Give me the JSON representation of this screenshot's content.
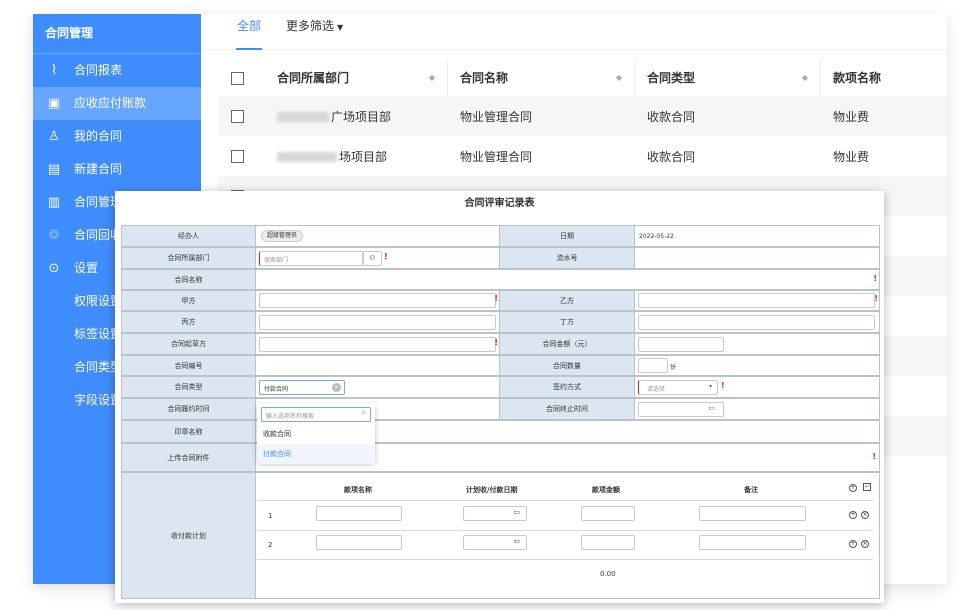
{
  "sidebar": {
    "title": "合同管理",
    "items": [
      {
        "label": "合同报表",
        "icon": "chart-line-icon",
        "active": false
      },
      {
        "label": "应收应付账款",
        "icon": "wallet-icon",
        "active": true
      },
      {
        "label": "我的合同",
        "icon": "user-icon",
        "active": false
      },
      {
        "label": "新建合同",
        "icon": "add-document-icon",
        "active": false
      },
      {
        "label": "合同管理",
        "icon": "manage-document-icon",
        "active": false
      },
      {
        "label": "合同回收",
        "icon": "recycle-bin-icon",
        "active": false
      },
      {
        "label": "设置",
        "icon": "settings-icon",
        "active": false
      }
    ],
    "sub_items": [
      "权限设置",
      "标签设置",
      "合同类型",
      "字段设置"
    ]
  },
  "tabs": {
    "all": "全部",
    "more": "更多筛选"
  },
  "table": {
    "headers": [
      "合同所属部门",
      "合同名称",
      "合同类型",
      "款项名称"
    ],
    "rows": [
      {
        "dept": "广场项目部",
        "name": "物业管理合同",
        "type": "收款合同",
        "item": "物业费"
      },
      {
        "dept": "场项目部",
        "name": "物业管理合同",
        "type": "收款合同",
        "item": "物业费"
      }
    ]
  },
  "form": {
    "title": "合同评审记录表",
    "labels": {
      "handler": "经办人",
      "date": "日期",
      "dept": "合同所属部门",
      "serial": "流水号",
      "name": "合同名称",
      "party_a": "甲方",
      "party_b": "乙方",
      "party_c": "丙方",
      "party_d": "丁方",
      "drafter": "合同起草方",
      "amount": "合同金额（元）",
      "number": "合同编号",
      "quantity": "合同数量",
      "type": "合同类型",
      "sign": "签约方式",
      "period": "合同履约时间",
      "end": "合同终止时间",
      "seal": "印章名称",
      "attach": "上传合同附件",
      "plan": "收付款计划"
    },
    "values": {
      "handler": "超级管理员",
      "date": "2022-05-22",
      "dept_placeholder": "搜索部门",
      "quantity_unit": "份",
      "type": "付款合同",
      "sign_placeholder": "请选择",
      "search_placeholder": "输入选项名称搜索",
      "required": "!"
    },
    "dropdown": [
      "收款合同",
      "付款合同"
    ],
    "plan": {
      "headers": [
        "款项名称",
        "计划收/付款日期",
        "款项金额",
        "备注"
      ],
      "rows": [
        "1",
        "2"
      ],
      "total": "0.00"
    }
  }
}
